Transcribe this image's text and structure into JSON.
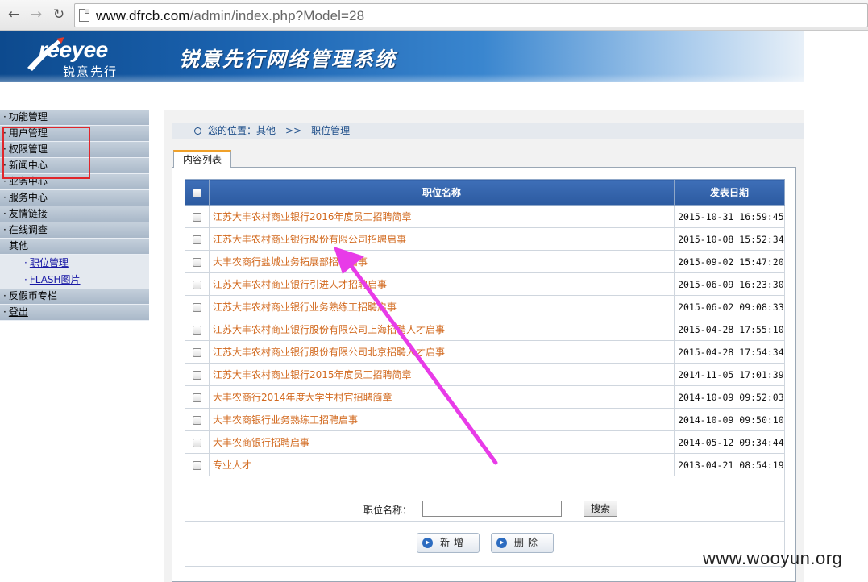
{
  "browser": {
    "url_host": "www.dfrcb.com",
    "url_path": "/admin/index.php?Model=28",
    "back_icon": "arrow-left-icon",
    "forward_icon": "arrow-right-icon",
    "reload_icon": "reload-icon"
  },
  "header": {
    "logo_brand": "reeyee",
    "logo_sub": "锐意先行",
    "system_title": "锐意先行网络管理系统"
  },
  "sidebar": {
    "items": [
      {
        "label": "功能管理"
      },
      {
        "label": "用户管理"
      },
      {
        "label": "权限管理"
      },
      {
        "label": "新闻中心"
      },
      {
        "label": "业务中心"
      },
      {
        "label": "服务中心"
      },
      {
        "label": "友情链接"
      },
      {
        "label": "在线调查"
      }
    ],
    "group": {
      "label": "其他",
      "children": [
        {
          "label": "职位管理"
        },
        {
          "label": "FLASH图片"
        }
      ]
    },
    "after": [
      {
        "label": "反假币专栏"
      },
      {
        "label": "登出"
      }
    ]
  },
  "breadcrumb": {
    "prefix": "您的位置：",
    "level1": "其他",
    "sep": ">>",
    "level2": "职位管理"
  },
  "tab": {
    "label": "内容列表"
  },
  "table": {
    "headers": {
      "title": "职位名称",
      "date": "发表日期"
    },
    "rows": [
      {
        "title": "江苏大丰农村商业银行2016年度员工招聘简章",
        "date": "2015-10-31 16:59:45"
      },
      {
        "title": "江苏大丰农村商业银行股份有限公司招聘启事",
        "date": "2015-10-08 15:52:34"
      },
      {
        "title": "大丰农商行盐城业务拓展部招聘启事",
        "date": "2015-09-02 15:47:20"
      },
      {
        "title": "江苏大丰农村商业银行引进人才招聘启事",
        "date": "2015-06-09 16:23:30"
      },
      {
        "title": "江苏大丰农村商业银行业务熟练工招聘启事",
        "date": "2015-06-02 09:08:33"
      },
      {
        "title": "江苏大丰农村商业银行股份有限公司上海招聘人才启事",
        "date": "2015-04-28 17:55:10"
      },
      {
        "title": "江苏大丰农村商业银行股份有限公司北京招聘人才启事",
        "date": "2015-04-28 17:54:34"
      },
      {
        "title": "江苏大丰农村商业银行2015年度员工招聘简章",
        "date": "2014-11-05 17:01:39"
      },
      {
        "title": "大丰农商行2014年度大学生村官招聘简章",
        "date": "2014-10-09 09:52:03"
      },
      {
        "title": "大丰农商银行业务熟练工招聘启事",
        "date": "2014-10-09 09:50:10"
      },
      {
        "title": "大丰农商银行招聘启事",
        "date": "2014-05-12 09:34:44"
      },
      {
        "title": "专业人才",
        "date": "2013-04-21 08:54:19"
      }
    ]
  },
  "search": {
    "label": "职位名称：",
    "value": "",
    "button": "搜索"
  },
  "actions": {
    "add": "新增",
    "delete": "删除"
  },
  "colors": {
    "highlight_box": "#e0262b",
    "arrow": "#e83be8",
    "title_text": "#d2691e",
    "header_bg": "#2c5aa0"
  },
  "watermark": "www.wooyun.org"
}
